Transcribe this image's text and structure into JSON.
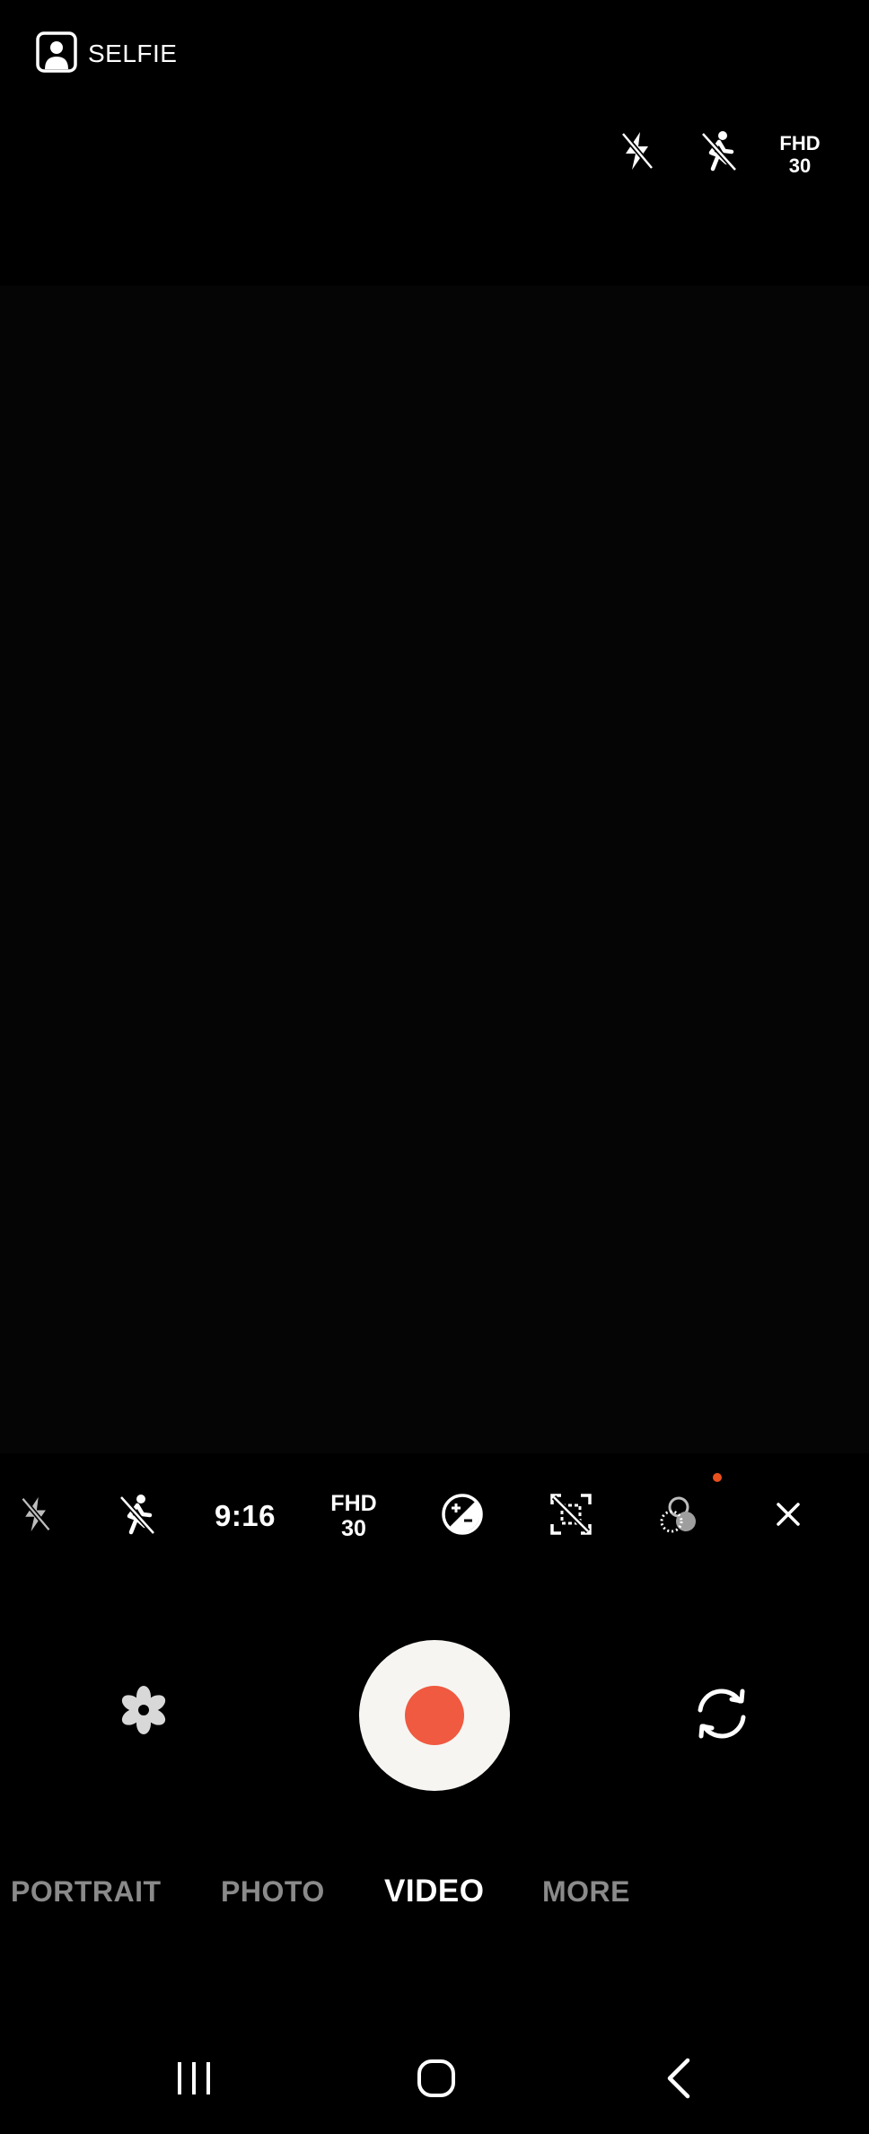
{
  "top_bar": {
    "selfie_label": "SELFIE",
    "flash_icon": "flash-off-icon",
    "motion_icon": "motion-off-icon",
    "resolution": {
      "line1": "FHD",
      "line2": "30"
    }
  },
  "quick_settings": {
    "items": [
      {
        "icon": "flash-off-icon"
      },
      {
        "icon": "motion-off-icon"
      },
      {
        "label": "9:16"
      },
      {
        "line1": "FHD",
        "line2": "30"
      },
      {
        "icon": "exposure-icon"
      },
      {
        "icon": "auto-framing-off-icon"
      },
      {
        "icon": "filters-icon",
        "has_notification": true
      },
      {
        "icon": "close-icon"
      }
    ],
    "notification_color": "#e8501e"
  },
  "controls": {
    "effects_icon": "flower-icon",
    "record_color": "#ef5a40",
    "switch_icon": "switch-camera-icon"
  },
  "modes": {
    "items": [
      "PORTRAIT",
      "PHOTO",
      "VIDEO",
      "MORE"
    ],
    "active": "VIDEO"
  },
  "nav": {
    "recents_icon": "recents-icon",
    "home_icon": "home-icon",
    "back_icon": "back-icon"
  }
}
